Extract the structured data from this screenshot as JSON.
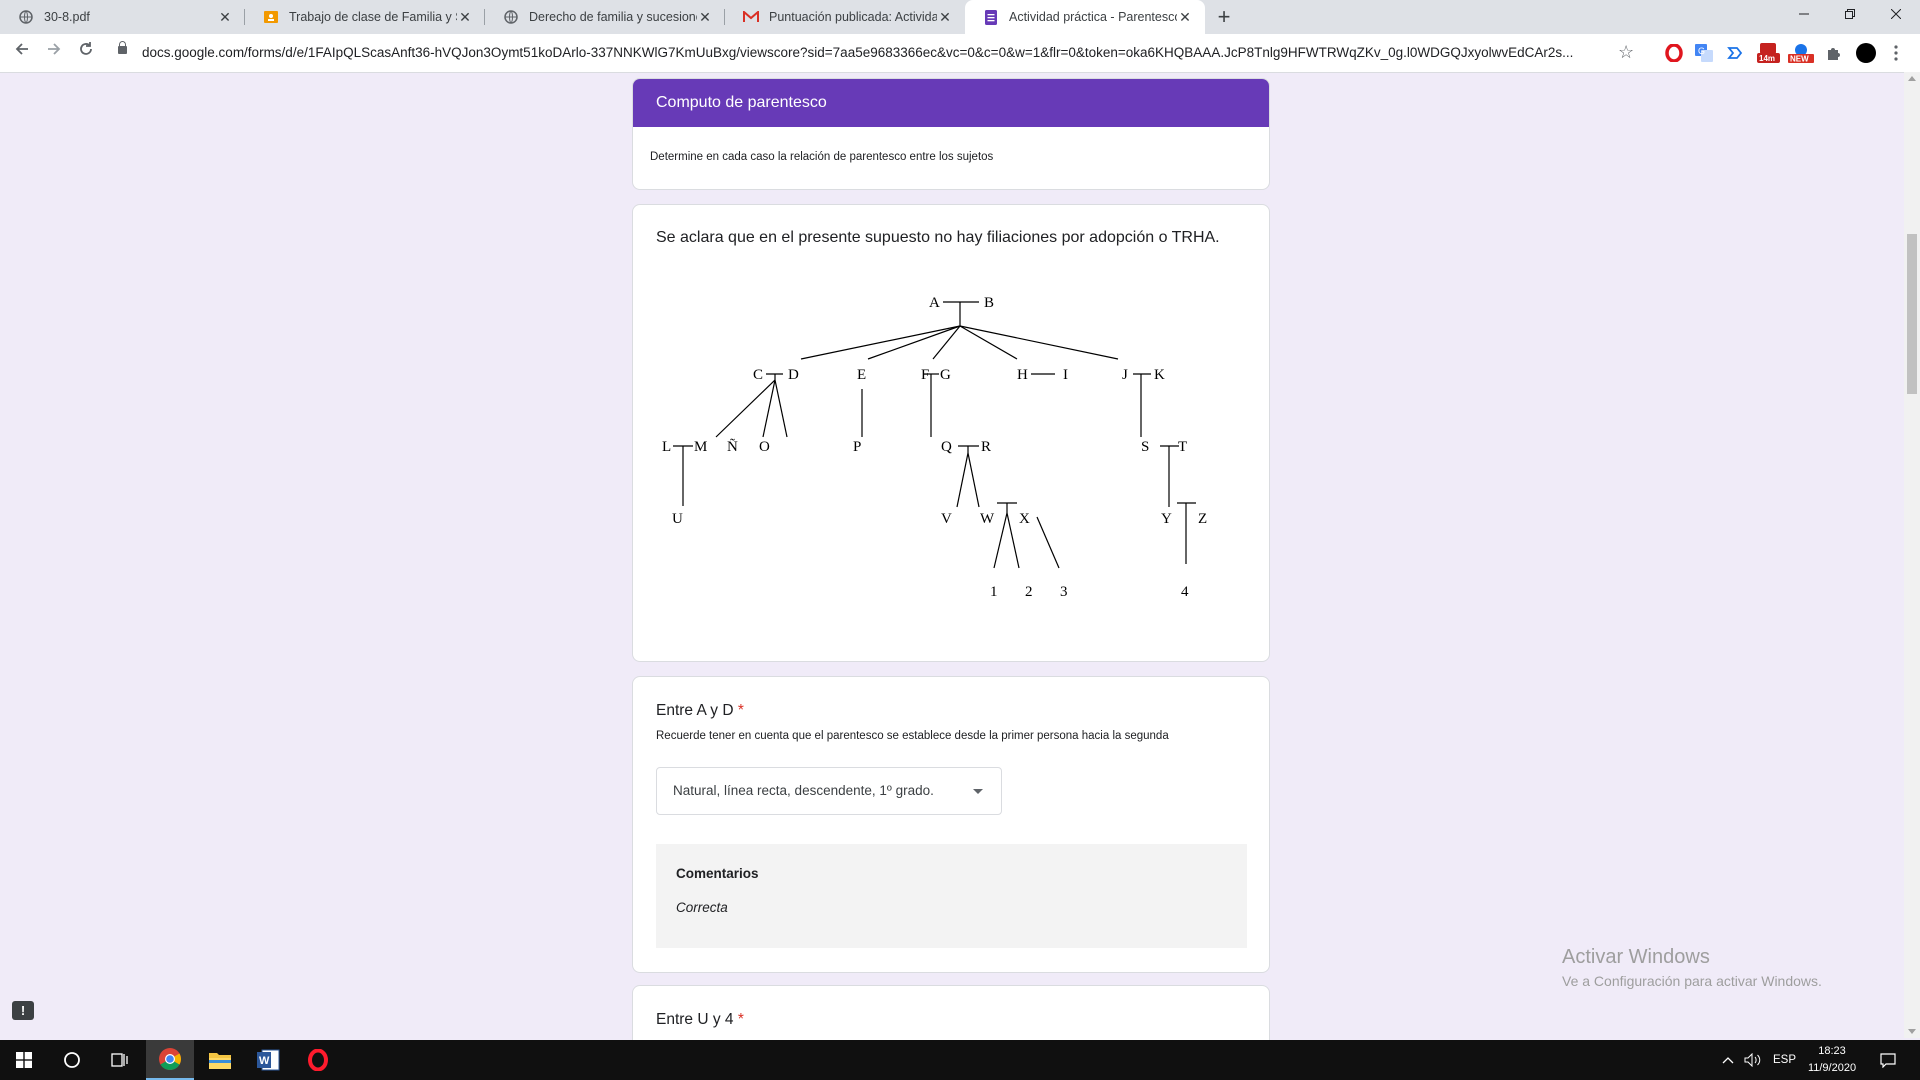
{
  "browser": {
    "tabs": [
      {
        "title": "30-8.pdf",
        "icon": "globe-icon"
      },
      {
        "title": "Trabajo de clase de Familia y Suc",
        "icon": "classroom-icon"
      },
      {
        "title": "Derecho de familia y sucesiones",
        "icon": "globe-icon"
      },
      {
        "title": "Puntuación publicada: Actividad",
        "icon": "gmail-icon"
      },
      {
        "title": "Actividad práctica - Parentesco",
        "icon": "forms-icon"
      }
    ],
    "new_tab": "+",
    "url": "docs.google.com/forms/d/e/1FAIpQLScasAnft36-hVQJon3Oymt51koDArlo-337NNKWlG7KmUuBxg/viewscore?sid=7aa5e9683366ec&vc=0&c=0&w=1&flr=0&token=oka6KHQBAAA.JcP8Tnlg9HFWTRWqZKv_0g.l0WDGQJxyolwvEdCAr2s...",
    "ext_badges": {
      "timer": "14m",
      "new": "NEW"
    }
  },
  "form": {
    "section_title": "Computo de parentesco",
    "section_description": "Determine en cada caso la relación de parentesco entre los sujetos",
    "question1": {
      "text": "Se aclara que en el presente supuesto no hay filiaciones por adopción o TRHA.",
      "tree_labels": {
        "A": "A",
        "B": "B",
        "C": "C",
        "D": "D",
        "E": "E",
        "F": "F",
        "G": "G",
        "H": "H",
        "I": "I",
        "J": "J",
        "K": "K",
        "L": "L",
        "M": "M",
        "N": "Ñ",
        "O": "O",
        "P": "P",
        "Q": "Q",
        "R": "R",
        "S": "S",
        "T": "T",
        "U": "U",
        "V": "V",
        "W": "W",
        "X": "X",
        "Y": "Y",
        "Z": "Z",
        "n1": "1",
        "n2": "2",
        "n3": "3",
        "n4": "4"
      }
    },
    "question2": {
      "title": "Entre A y D",
      "required": "*",
      "help": "Recuerde tener en cuenta que el parentesco se establece desde la primer persona hacia la segunda",
      "selected": "Natural, línea recta, descendente, 1º grado.",
      "comments_title": "Comentarios",
      "comments_text": "Correcta"
    },
    "question3": {
      "title": "Entre U y 4",
      "required": "*"
    }
  },
  "feedback_icon": "!",
  "watermark": {
    "line1": "Activar Windows",
    "line2": "Ve a Configuración para activar Windows."
  },
  "taskbar": {
    "language": "ESP",
    "time": "18:23",
    "date": "11/9/2020"
  },
  "colors": {
    "form_accent": "#673ab7",
    "background": "#f0ebf8",
    "required": "#d93025"
  }
}
